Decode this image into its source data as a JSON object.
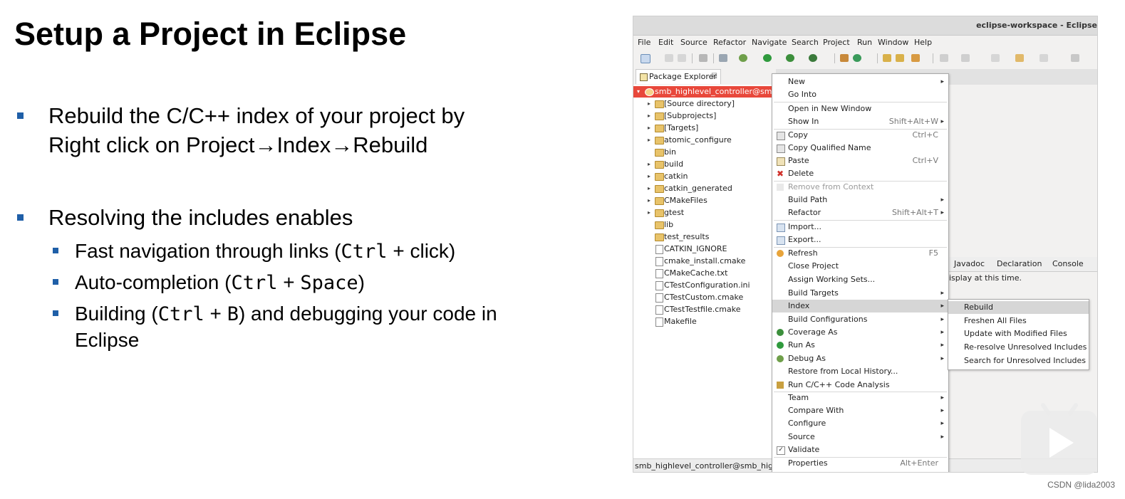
{
  "slide": {
    "title": "Setup a Project in Eclipse",
    "bullet1_line1": "Rebuild the C/C++ index of your project by",
    "bullet1_line2": "Right click on Project→Index→Rebuild",
    "bullet2": "Resolving the includes enables",
    "sub1_a": "Fast navigation through links (",
    "sub1_code": "Ctrl",
    "sub1_b": " + click)",
    "sub2_a": "Auto-completion (",
    "sub2_code1": "Ctrl",
    "sub2_plus": " + ",
    "sub2_code2": "Space",
    "sub2_b": ")",
    "sub3_a": "Building (",
    "sub3_code1": "Ctrl",
    "sub3_plus": " + ",
    "sub3_code2": "B",
    "sub3_b": ") and debugging your code in",
    "sub3_line2": "Eclipse",
    "bullet_color": "#1f5fa8"
  },
  "eclipse": {
    "window_title": "eclipse-workspace - Eclipse",
    "menu": [
      "File",
      "Edit",
      "Source",
      "Refactor",
      "Navigate",
      "Search",
      "Project",
      "Run",
      "Window",
      "Help"
    ],
    "package_explorer_tab": "Package Explorer",
    "tab_close": "☒",
    "tree": [
      {
        "label": "smb_highlevel_controller@smb_h",
        "type": "project",
        "twisty": "▾"
      },
      {
        "label": "[Source directory]",
        "type": "folder",
        "twisty": "▸"
      },
      {
        "label": "[Subprojects]",
        "type": "folder",
        "twisty": "▸"
      },
      {
        "label": "[Targets]",
        "type": "folder",
        "twisty": "▸"
      },
      {
        "label": "atomic_configure",
        "type": "folder",
        "twisty": "▸"
      },
      {
        "label": "bin",
        "type": "folder",
        "twisty": ""
      },
      {
        "label": "build",
        "type": "folder",
        "twisty": "▸"
      },
      {
        "label": "catkin",
        "type": "folder",
        "twisty": "▸"
      },
      {
        "label": "catkin_generated",
        "type": "folder",
        "twisty": "▸"
      },
      {
        "label": "CMakeFiles",
        "type": "folder",
        "twisty": "▸"
      },
      {
        "label": "gtest",
        "type": "folder",
        "twisty": "▸"
      },
      {
        "label": "lib",
        "type": "folder",
        "twisty": ""
      },
      {
        "label": "test_results",
        "type": "folder",
        "twisty": ""
      },
      {
        "label": "CATKIN_IGNORE",
        "type": "file",
        "twisty": ""
      },
      {
        "label": "cmake_install.cmake",
        "type": "file",
        "twisty": ""
      },
      {
        "label": "CMakeCache.txt",
        "type": "file",
        "twisty": ""
      },
      {
        "label": "CTestConfiguration.ini",
        "type": "file",
        "twisty": ""
      },
      {
        "label": "CTestCustom.cmake",
        "type": "file",
        "twisty": ""
      },
      {
        "label": "CTestTestfile.cmake",
        "type": "file",
        "twisty": ""
      },
      {
        "label": "Makefile",
        "type": "file",
        "twisty": ""
      }
    ],
    "context_menu": [
      {
        "label": "New",
        "shortcut": "",
        "submenu": true,
        "icon": ""
      },
      {
        "label": "Go Into",
        "shortcut": "",
        "submenu": false,
        "icon": ""
      },
      {
        "sep": true
      },
      {
        "label": "Open in New Window",
        "shortcut": "",
        "submenu": false,
        "icon": ""
      },
      {
        "label": "Show In",
        "shortcut": "Shift+Alt+W",
        "submenu": true,
        "icon": ""
      },
      {
        "sep": true
      },
      {
        "label": "Copy",
        "shortcut": "Ctrl+C",
        "submenu": false,
        "icon": "copy-icon"
      },
      {
        "label": "Copy Qualified Name",
        "shortcut": "",
        "submenu": false,
        "icon": "copy-icon"
      },
      {
        "label": "Paste",
        "shortcut": "Ctrl+V",
        "submenu": false,
        "icon": "paste-icon"
      },
      {
        "label": "Delete",
        "shortcut": "",
        "submenu": false,
        "icon": "delete-icon"
      },
      {
        "sep": true
      },
      {
        "label": "Remove from Context",
        "shortcut": "",
        "submenu": false,
        "icon": "remove-context-icon",
        "disabled": true
      },
      {
        "label": "Build Path",
        "shortcut": "",
        "submenu": true,
        "icon": ""
      },
      {
        "label": "Refactor",
        "shortcut": "Shift+Alt+T",
        "submenu": true,
        "icon": ""
      },
      {
        "sep": true
      },
      {
        "label": "Import...",
        "shortcut": "",
        "submenu": false,
        "icon": "import-icon"
      },
      {
        "label": "Export...",
        "shortcut": "",
        "submenu": false,
        "icon": "export-icon"
      },
      {
        "sep": true
      },
      {
        "label": "Refresh",
        "shortcut": "F5",
        "submenu": false,
        "icon": "refresh-icon"
      },
      {
        "label": "Close Project",
        "shortcut": "",
        "submenu": false,
        "icon": ""
      },
      {
        "label": "Assign Working Sets...",
        "shortcut": "",
        "submenu": false,
        "icon": ""
      },
      {
        "label": "Build Targets",
        "shortcut": "",
        "submenu": true,
        "icon": ""
      },
      {
        "label": "Index",
        "shortcut": "",
        "submenu": true,
        "icon": "",
        "highlighted": true
      },
      {
        "label": "Build Configurations",
        "shortcut": "",
        "submenu": true,
        "icon": ""
      },
      {
        "label": "Coverage As",
        "shortcut": "",
        "submenu": true,
        "icon": "coverage-icon"
      },
      {
        "label": "Run As",
        "shortcut": "",
        "submenu": true,
        "icon": "run-icon"
      },
      {
        "label": "Debug As",
        "shortcut": "",
        "submenu": true,
        "icon": "debug-icon"
      },
      {
        "label": "Restore from Local History...",
        "shortcut": "",
        "submenu": false,
        "icon": ""
      },
      {
        "label": "Run C/C++ Code Analysis",
        "shortcut": "",
        "submenu": false,
        "icon": "code-analysis-icon"
      },
      {
        "sep": true
      },
      {
        "label": "Team",
        "shortcut": "",
        "submenu": true,
        "icon": ""
      },
      {
        "label": "Compare With",
        "shortcut": "",
        "submenu": true,
        "icon": ""
      },
      {
        "label": "Configure",
        "shortcut": "",
        "submenu": true,
        "icon": ""
      },
      {
        "label": "Source",
        "shortcut": "",
        "submenu": true,
        "icon": ""
      },
      {
        "label": "Validate",
        "shortcut": "",
        "submenu": false,
        "icon": "validate-icon"
      },
      {
        "sep": true
      },
      {
        "label": "Properties",
        "shortcut": "Alt+Enter",
        "submenu": false,
        "icon": ""
      }
    ],
    "index_submenu": [
      {
        "label": "Rebuild",
        "highlighted": true
      },
      {
        "label": "Freshen All Files"
      },
      {
        "label": "Update with Modified Files"
      },
      {
        "label": "Re-resolve Unresolved Includes"
      },
      {
        "label": "Search for Unresolved Includes"
      }
    ],
    "bottom_tabs": [
      "Javadoc",
      "Declaration",
      "Console"
    ],
    "console_message": "isplay at this time.",
    "status_text": "smb_highlevel_controller@smb_highlev"
  },
  "watermark": "CSDN @lida2003"
}
